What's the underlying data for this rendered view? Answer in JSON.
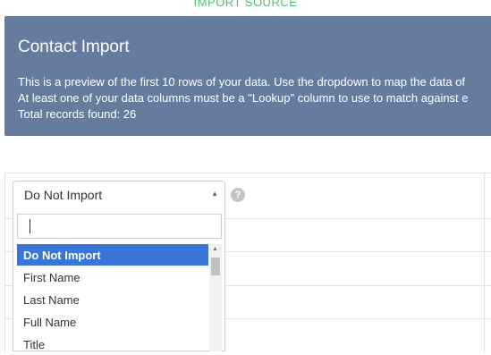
{
  "top_link": "IMPORT SOURCE",
  "panel": {
    "title": "Contact Import",
    "line1": "This is a preview of the first 10 rows of your data. Use the dropdown to map the data of",
    "line2": "At least one of your data columns must be a \"Lookup\" column to use to match against e",
    "line3": "Total records found: 26"
  },
  "select": {
    "value": "Do Not Import",
    "arrow": "▲"
  },
  "help": {
    "glyph": "?"
  },
  "dropdown": {
    "search_value": "",
    "options": [
      "Do Not Import",
      "First Name",
      "Last Name",
      "Full Name",
      "Title"
    ],
    "selected_index": 0
  },
  "colors": {
    "panel": "#667c9e",
    "accent": "#4cbf73",
    "selected": "#3875d7"
  }
}
